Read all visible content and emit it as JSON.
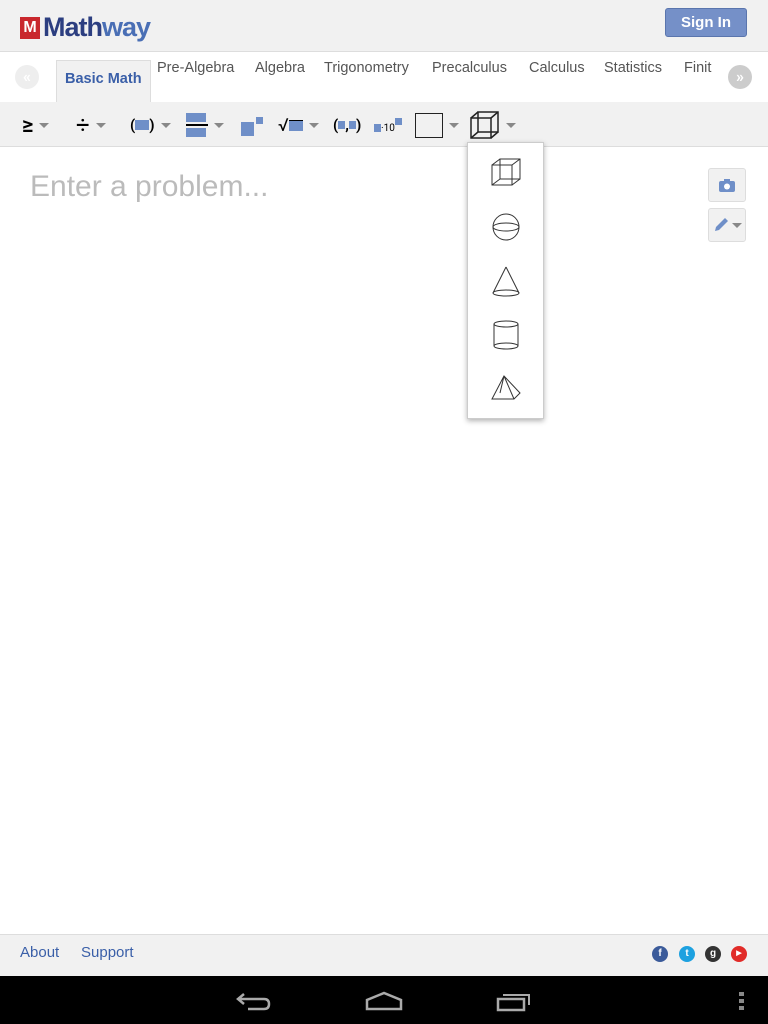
{
  "header": {
    "logo_text": "Mathway",
    "sign_in": "Sign In"
  },
  "tabs": {
    "items": [
      "Basic Math",
      "Pre-Algebra",
      "Algebra",
      "Trigonometry",
      "Precalculus",
      "Calculus",
      "Statistics",
      "Finit"
    ],
    "active": "Basic Math"
  },
  "toolbar": {
    "ge": "≥",
    "div": "÷",
    "sci": "·10"
  },
  "editor": {
    "placeholder": "Enter a problem..."
  },
  "dropdown": {
    "items": [
      "cube-icon",
      "sphere-icon",
      "cone-icon",
      "cylinder-icon",
      "pyramid-icon"
    ]
  },
  "footer": {
    "about": "About",
    "support": "Support",
    "social": [
      "facebook-icon",
      "twitter-icon",
      "google-plus-icon",
      "youtube-icon"
    ]
  },
  "colors": {
    "accent": "#3a5fa8",
    "button": "#7590c8",
    "block": "#6f8fc8"
  }
}
